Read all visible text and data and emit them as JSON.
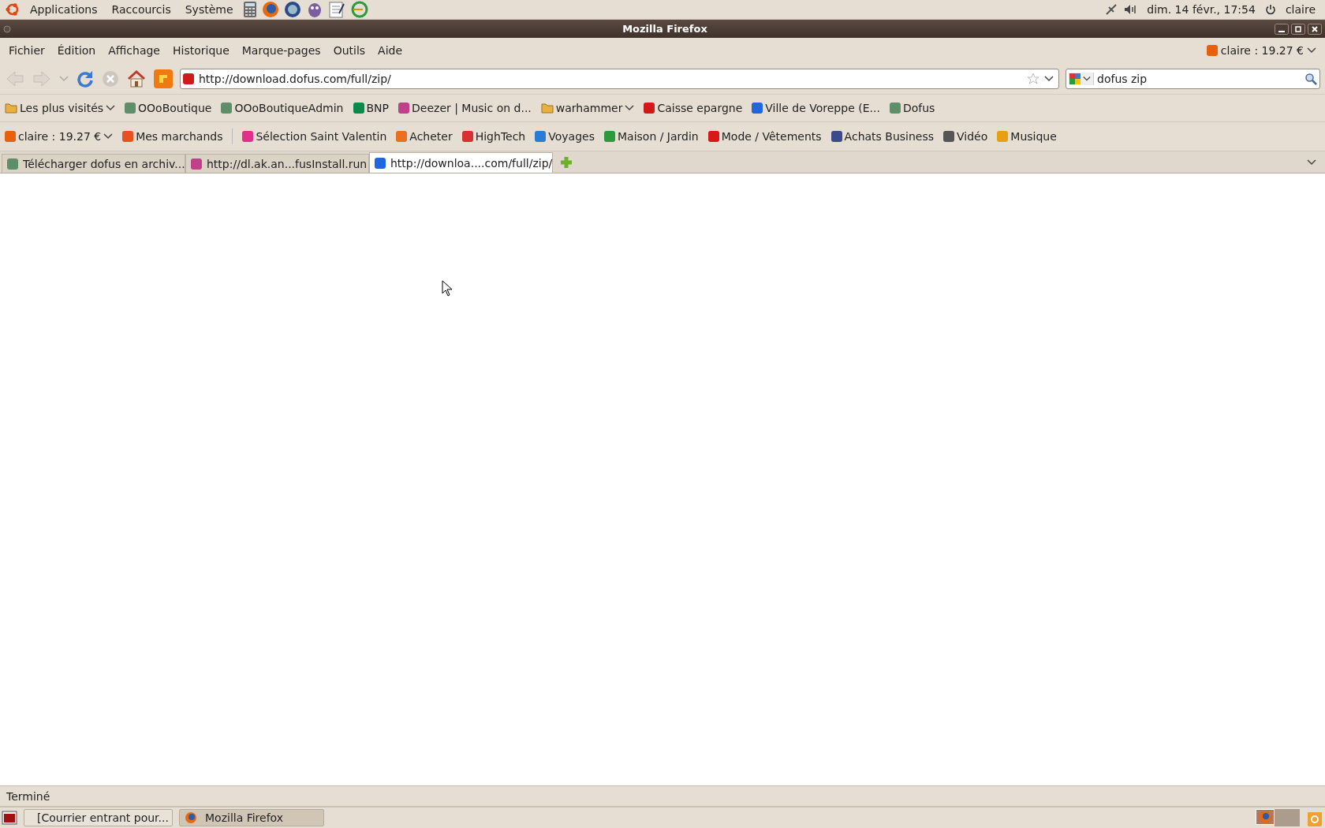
{
  "top_panel": {
    "menus": [
      "Applications",
      "Raccourcis",
      "Système"
    ],
    "clock": "dim. 14 févr., 17:54",
    "user": "claire"
  },
  "window": {
    "title": "Mozilla Firefox"
  },
  "menu_bar": [
    "Fichier",
    "Édition",
    "Affichage",
    "Historique",
    "Marque-pages",
    "Outils",
    "Aide"
  ],
  "account": {
    "label": "claire : 19.27 €"
  },
  "navigation": {
    "url": "http://download.dofus.com/full/zip/",
    "search": "dofus zip"
  },
  "bookmarks": [
    {
      "kind": "folder",
      "label": "Les plus visités",
      "dropdown": true
    },
    {
      "kind": "site",
      "label": "OOoBoutique",
      "dropdown": false
    },
    {
      "kind": "site",
      "label": "OOoBoutiqueAdmin",
      "dropdown": false
    },
    {
      "kind": "site",
      "label": "BNP",
      "dropdown": false
    },
    {
      "kind": "site",
      "label": "Deezer | Music on d...",
      "dropdown": false
    },
    {
      "kind": "folder",
      "label": "warhammer",
      "dropdown": true
    },
    {
      "kind": "site",
      "label": "Caisse epargne",
      "dropdown": false
    },
    {
      "kind": "site",
      "label": "Ville de Voreppe (E...",
      "dropdown": false
    },
    {
      "kind": "site",
      "label": "Dofus",
      "dropdown": false
    }
  ],
  "shopping_bar": [
    {
      "label": "claire : 19.27 €",
      "dropdown": true
    },
    {
      "label": "Mes marchands",
      "dropdown": false
    },
    {
      "label": "Sélection Saint Valentin",
      "dropdown": false
    },
    {
      "label": "Acheter",
      "dropdown": false
    },
    {
      "label": "HighTech",
      "dropdown": false
    },
    {
      "label": "Voyages",
      "dropdown": false
    },
    {
      "label": "Maison / Jardin",
      "dropdown": false
    },
    {
      "label": "Mode / Vêtements",
      "dropdown": false
    },
    {
      "label": "Achats Business",
      "dropdown": false
    },
    {
      "label": "Vidéo",
      "dropdown": false
    },
    {
      "label": "Musique",
      "dropdown": false
    }
  ],
  "tabs": [
    {
      "label": "Télécharger dofus en archiv...",
      "selected": false
    },
    {
      "label": "http://dl.ak.an...fusInstall.run",
      "selected": false
    },
    {
      "label": "http://downloa....com/full/zip/",
      "selected": true
    }
  ],
  "status_bar": "Terminé",
  "taskbar": [
    {
      "label": "[Courrier entrant pour...",
      "selected": false
    },
    {
      "label": "Mozilla Firefox",
      "selected": true
    }
  ]
}
